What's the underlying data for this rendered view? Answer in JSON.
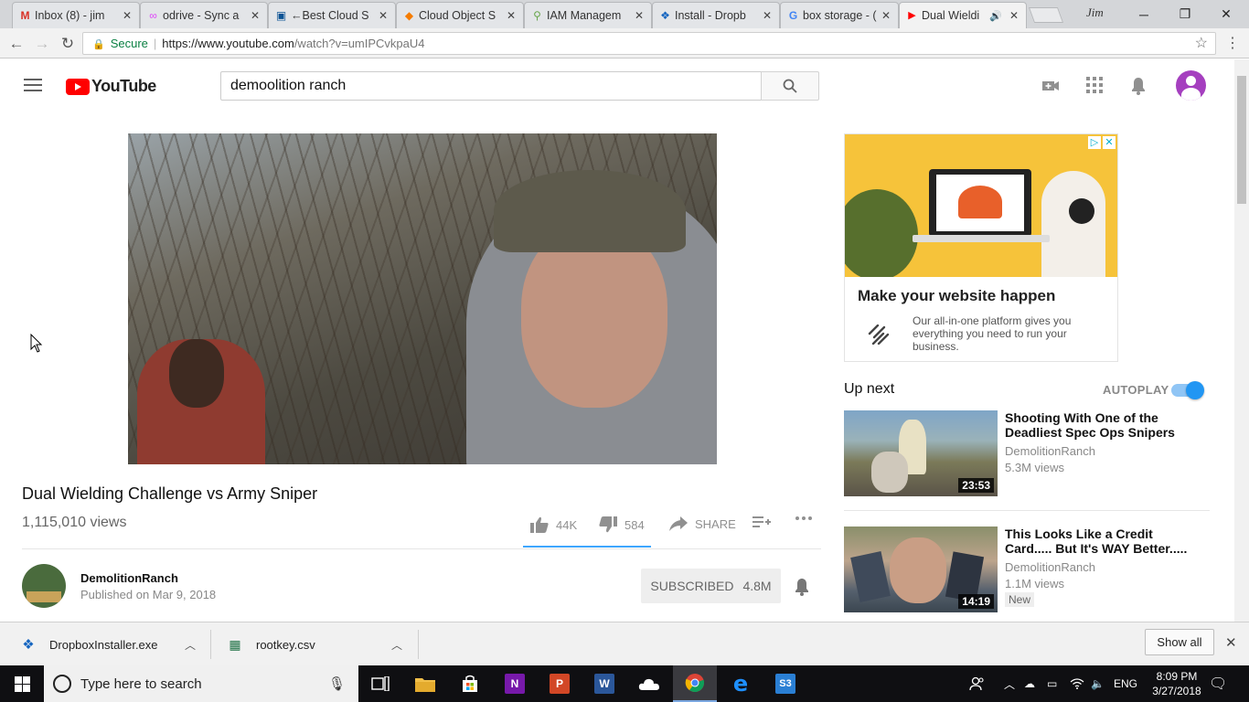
{
  "browser": {
    "tabs": [
      {
        "label": "Inbox (8) - jim",
        "icon": "gmail-icon",
        "favicon": "M",
        "color": "#d93025",
        "active": false
      },
      {
        "label": "odrive - Sync a",
        "icon": "odrive-icon",
        "favicon": "∞",
        "color": "#e040fb",
        "active": false
      },
      {
        "label": "←Best Cloud S",
        "icon": "cloud-site-icon",
        "favicon": "▣",
        "color": "#0b5394",
        "active": false
      },
      {
        "label": "Cloud Object S",
        "icon": "cube-icon",
        "favicon": "◆",
        "color": "#f57c00",
        "active": false
      },
      {
        "label": "IAM Managem",
        "icon": "key-icon",
        "favicon": "⚲",
        "color": "#6aa84f",
        "active": false
      },
      {
        "label": "Install - Dropb",
        "icon": "dropbox-icon",
        "favicon": "❖",
        "color": "#1565c0",
        "active": false
      },
      {
        "label": "box storage - (",
        "icon": "google-icon",
        "favicon": "G",
        "color": "#4285f4",
        "active": false
      },
      {
        "label": "Dual Wieldi",
        "icon": "youtube-icon",
        "favicon": "▶",
        "color": "#ff0000",
        "active": true
      }
    ],
    "profile_label": "Jim",
    "secure_label": "Secure",
    "url_host": "https://www.youtube.com",
    "url_path": "/watch?v=umIPCvkpaU4"
  },
  "youtube": {
    "logo_text": "YouTube",
    "search_value": "demoolition ranch",
    "video": {
      "title": "Dual Wielding Challenge vs Army Sniper",
      "views": "1,115,010 views",
      "likes": "44K",
      "dislikes": "584",
      "share_label": "SHARE",
      "like_ratio": 0.987
    },
    "channel": {
      "name": "DemolitionRanch",
      "published": "Published on Mar 9, 2018",
      "subscribed_label": "SUBSCRIBED",
      "subscriber_count": "4.8M"
    },
    "ad": {
      "headline": "Make your website happen",
      "body": "Our all-in-one platform gives you everything you need to run your business."
    },
    "up_next_label": "Up next",
    "autoplay_label": "AUTOPLAY",
    "autoplay_on": true,
    "recommendations": [
      {
        "title": "Shooting With One of the Deadliest Spec Ops Snipers",
        "channel": "DemolitionRanch",
        "views": "5.3M views",
        "duration": "23:53",
        "badge": ""
      },
      {
        "title": "This Looks Like a Credit Card..... But It's WAY Better.....",
        "channel": "DemolitionRanch",
        "views": "1.1M views",
        "duration": "14:19",
        "badge": "New"
      }
    ]
  },
  "downloads": {
    "items": [
      {
        "name": "DropboxInstaller.exe",
        "icon": "dropbox-icon"
      },
      {
        "name": "rootkey.csv",
        "icon": "spreadsheet-icon"
      }
    ],
    "show_all_label": "Show all"
  },
  "taskbar": {
    "search_placeholder": "Type here to search",
    "language": "ENG",
    "time": "8:09 PM",
    "date": "3/27/2018",
    "apps": [
      {
        "name": "task-view-icon"
      },
      {
        "name": "file-explorer-icon"
      },
      {
        "name": "store-icon"
      },
      {
        "name": "onenote-icon",
        "letter": "N",
        "color": "#7719aa"
      },
      {
        "name": "powerpoint-icon",
        "letter": "P",
        "color": "#d24726"
      },
      {
        "name": "word-icon",
        "letter": "W",
        "color": "#2b579a"
      },
      {
        "name": "onedrive-icon"
      },
      {
        "name": "chrome-icon"
      },
      {
        "name": "edge-icon"
      },
      {
        "name": "s3-browser-icon",
        "letter": "S3",
        "color": "#2a7fd4"
      }
    ]
  }
}
